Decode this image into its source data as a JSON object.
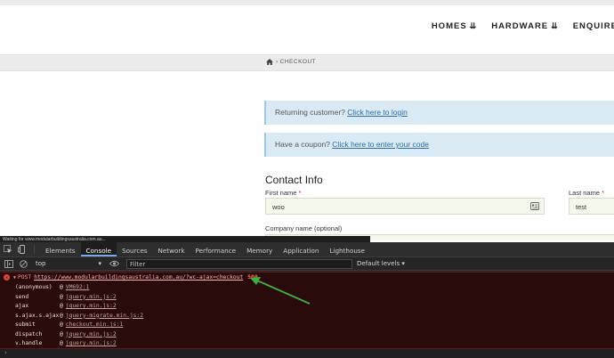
{
  "nav": {
    "items": [
      "HOMES",
      "HARDWARE",
      "ENQUIRE"
    ]
  },
  "breadcrumb": {
    "current": "CHECKOUT"
  },
  "notices": {
    "login_text": "Returning customer?",
    "login_link": "Click here to login",
    "coupon_text": "Have a coupon?",
    "coupon_link": "Click here to enter your code"
  },
  "form": {
    "title": "Contact Info",
    "first_name_label": "First name",
    "last_name_label": "Last name",
    "required_mark": "*",
    "first_name_value": "woo",
    "last_name_value": "test",
    "company_label": "Company name (optional)"
  },
  "status_tip": "Waiting for www.modularbuildingsaustralia.com.au...",
  "devtools": {
    "tabs": [
      "Elements",
      "Console",
      "Sources",
      "Network",
      "Performance",
      "Memory",
      "Application",
      "Lighthouse"
    ],
    "active_tab": "Console",
    "context": "top",
    "filter_placeholder": "Filter",
    "levels": "Default levels",
    "levels_caret": "▾",
    "prompt": "›"
  },
  "console": {
    "error": {
      "method": "POST",
      "url": "https://www.modularbuildingsaustralia.com.au/?wc-ajax=checkout",
      "status": "500"
    },
    "stack": [
      {
        "fn": "(anonymous)",
        "loc": "VM692:1"
      },
      {
        "fn": "send",
        "loc": "jquery.min.js:2"
      },
      {
        "fn": "ajax",
        "loc": "jquery.min.js:2"
      },
      {
        "fn": "s.ajax.s.ajax",
        "loc": "jquery-migrate.min.js:2"
      },
      {
        "fn": "submit",
        "loc": "checkout.min.js:1"
      },
      {
        "fn": "dispatch",
        "loc": "jquery.min.js:2"
      },
      {
        "fn": "v.handle",
        "loc": "jquery.min.js:2"
      }
    ],
    "at_symbol": "@"
  },
  "colors": {
    "accent": "#7aa7e8",
    "error": "#e24343",
    "arrow": "#3fae3f",
    "notice_bg": "#d9eaf4"
  }
}
